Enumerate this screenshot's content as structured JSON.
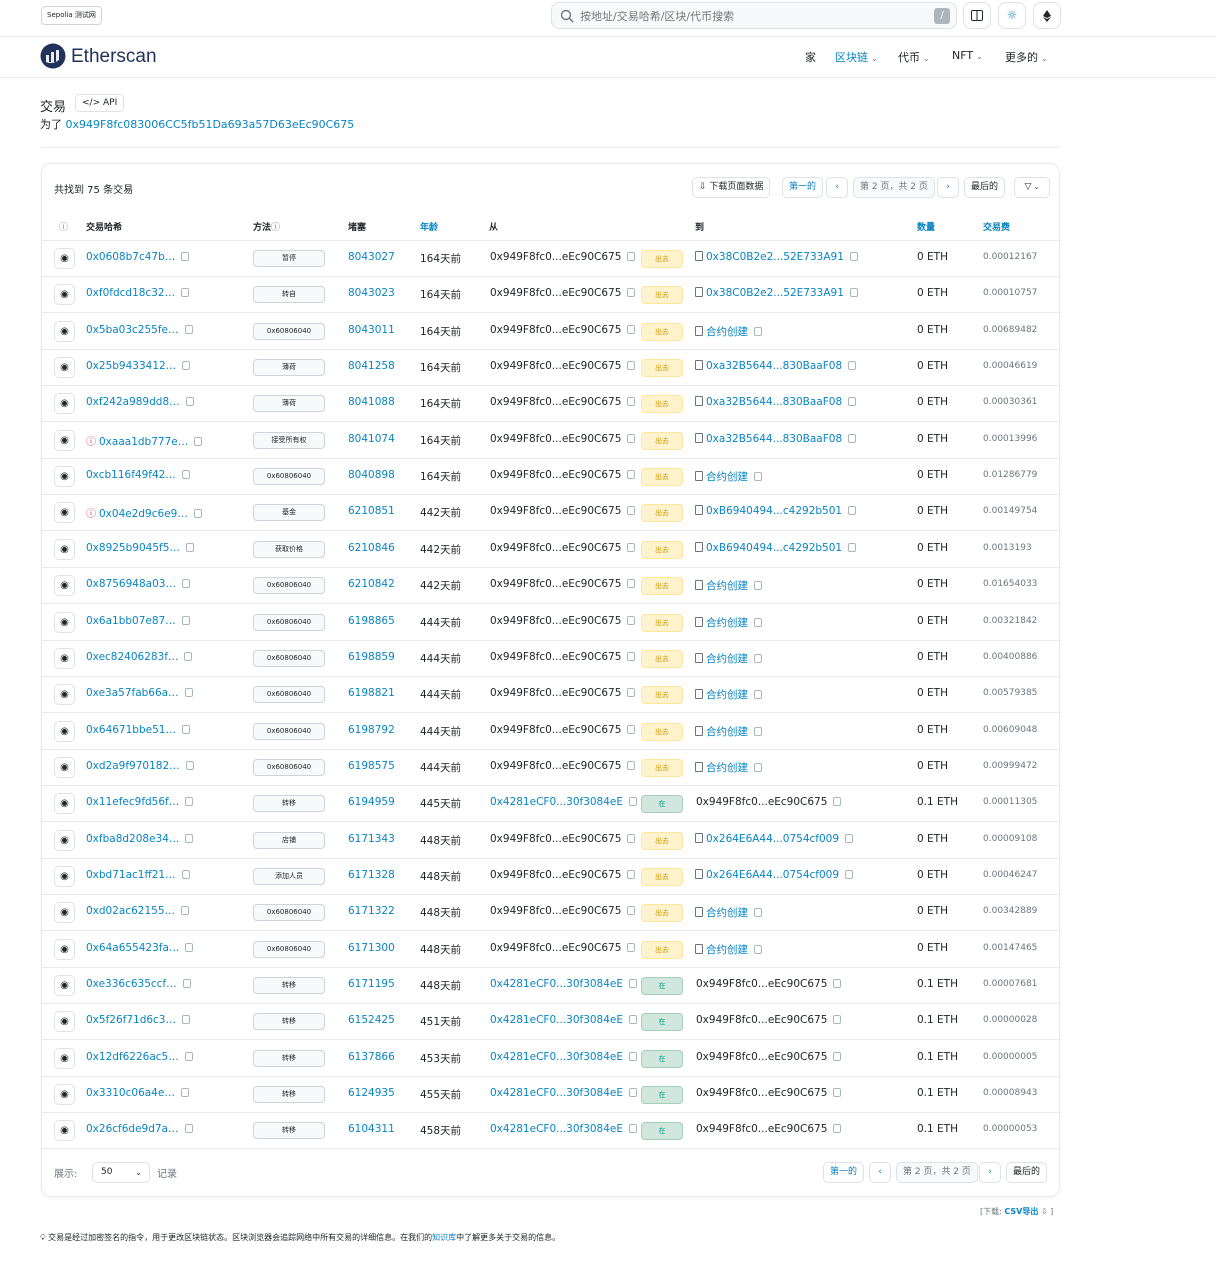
{
  "topbar": {
    "network": "Sepolia 测试网",
    "search_placeholder": "按地址/交易哈希/区块/代币搜索",
    "slash_key": "/"
  },
  "header": {
    "logo_text": "Etherscan",
    "nav": [
      {
        "label": "家",
        "dropdown": false,
        "active": false
      },
      {
        "label": "区块链",
        "dropdown": true,
        "active": true
      },
      {
        "label": "代币",
        "dropdown": true,
        "active": false
      },
      {
        "label": "NFT",
        "dropdown": true,
        "active": false
      },
      {
        "label": "更多的",
        "dropdown": true,
        "active": false
      }
    ]
  },
  "page": {
    "title": "交易",
    "api_label": "API",
    "for_prefix": "为了",
    "address": "0x949F8fc083006CC5fb51Da693a57D63eEc90C675"
  },
  "table_toolbar": {
    "found": "共找到 75 条交易",
    "download": "下载页面数据",
    "first": "第一的",
    "prev": "‹",
    "page_info": "第 2 页，共 2 页",
    "next": "›",
    "last": "最后的",
    "filter": "▽"
  },
  "columns": {
    "hash": "交易哈希",
    "method": "方法",
    "block": "堵塞",
    "age": "年龄",
    "from": "从",
    "to": "到",
    "amount": "数量",
    "fee": "交易费"
  },
  "rows": [
    {
      "hash": "0x0608b7c47b…",
      "err": false,
      "method": "暂停",
      "block": "8043027",
      "age": "164天前",
      "from": "0x949F8fc0...eEc90C675",
      "from_link": false,
      "dir": "出去",
      "dir_type": "out",
      "to": "0x38C0B2e2...52E733A91",
      "to_doc": true,
      "to_link": true,
      "amount": "0 ETH",
      "fee": "0.00012167"
    },
    {
      "hash": "0xf0fdcd18c32…",
      "err": false,
      "method": "转自",
      "block": "8043023",
      "age": "164天前",
      "from": "0x949F8fc0...eEc90C675",
      "from_link": false,
      "dir": "出去",
      "dir_type": "out",
      "to": "0x38C0B2e2...52E733A91",
      "to_doc": true,
      "to_link": true,
      "amount": "0 ETH",
      "fee": "0.00010757"
    },
    {
      "hash": "0x5ba03c255fe…",
      "err": false,
      "method": "0x60806040",
      "block": "8043011",
      "age": "164天前",
      "from": "0x949F8fc0...eEc90C675",
      "from_link": false,
      "dir": "出去",
      "dir_type": "out",
      "to": "合约创建",
      "to_doc": true,
      "to_link": true,
      "amount": "0 ETH",
      "fee": "0.00689482"
    },
    {
      "hash": "0x25b9433412…",
      "err": false,
      "method": "薄荷",
      "block": "8041258",
      "age": "164天前",
      "from": "0x949F8fc0...eEc90C675",
      "from_link": false,
      "dir": "出去",
      "dir_type": "out",
      "to": "0xa32B5644...830BaaF08",
      "to_doc": true,
      "to_link": true,
      "amount": "0 ETH",
      "fee": "0.00046619"
    },
    {
      "hash": "0xf242a989dd8…",
      "err": false,
      "method": "薄荷",
      "block": "8041088",
      "age": "164天前",
      "from": "0x949F8fc0...eEc90C675",
      "from_link": false,
      "dir": "出去",
      "dir_type": "out",
      "to": "0xa32B5644...830BaaF08",
      "to_doc": true,
      "to_link": true,
      "amount": "0 ETH",
      "fee": "0.00030361"
    },
    {
      "hash": "0xaaa1db777e…",
      "err": true,
      "method": "接受所有权",
      "block": "8041074",
      "age": "164天前",
      "from": "0x949F8fc0...eEc90C675",
      "from_link": false,
      "dir": "出去",
      "dir_type": "out",
      "to": "0xa32B5644...830BaaF08",
      "to_doc": true,
      "to_link": true,
      "amount": "0 ETH",
      "fee": "0.00013996"
    },
    {
      "hash": "0xcb116f49f42…",
      "err": false,
      "method": "0x60806040",
      "block": "8040898",
      "age": "164天前",
      "from": "0x949F8fc0...eEc90C675",
      "from_link": false,
      "dir": "出去",
      "dir_type": "out",
      "to": "合约创建",
      "to_doc": true,
      "to_link": true,
      "amount": "0 ETH",
      "fee": "0.01286779"
    },
    {
      "hash": "0x04e2d9c6e9…",
      "err": true,
      "method": "基金",
      "block": "6210851",
      "age": "442天前",
      "from": "0x949F8fc0...eEc90C675",
      "from_link": false,
      "dir": "出去",
      "dir_type": "out",
      "to": "0xB6940494...c4292b501",
      "to_doc": true,
      "to_link": true,
      "amount": "0 ETH",
      "fee": "0.00149754"
    },
    {
      "hash": "0x8925b9045f5…",
      "err": false,
      "method": "获取价格",
      "block": "6210846",
      "age": "442天前",
      "from": "0x949F8fc0...eEc90C675",
      "from_link": false,
      "dir": "出去",
      "dir_type": "out",
      "to": "0xB6940494...c4292b501",
      "to_doc": true,
      "to_link": true,
      "amount": "0 ETH",
      "fee": "0.0013193"
    },
    {
      "hash": "0x8756948a03…",
      "err": false,
      "method": "0x60806040",
      "block": "6210842",
      "age": "442天前",
      "from": "0x949F8fc0...eEc90C675",
      "from_link": false,
      "dir": "出去",
      "dir_type": "out",
      "to": "合约创建",
      "to_doc": true,
      "to_link": true,
      "amount": "0 ETH",
      "fee": "0.01654033"
    },
    {
      "hash": "0x6a1bb07e87…",
      "err": false,
      "method": "0x60806040",
      "block": "6198865",
      "age": "444天前",
      "from": "0x949F8fc0...eEc90C675",
      "from_link": false,
      "dir": "出去",
      "dir_type": "out",
      "to": "合约创建",
      "to_doc": true,
      "to_link": true,
      "amount": "0 ETH",
      "fee": "0.00321842"
    },
    {
      "hash": "0xec82406283f…",
      "err": false,
      "method": "0x60806040",
      "block": "6198859",
      "age": "444天前",
      "from": "0x949F8fc0...eEc90C675",
      "from_link": false,
      "dir": "出去",
      "dir_type": "out",
      "to": "合约创建",
      "to_doc": true,
      "to_link": true,
      "amount": "0 ETH",
      "fee": "0.00400886"
    },
    {
      "hash": "0xe3a57fab66a…",
      "err": false,
      "method": "0x60806040",
      "block": "6198821",
      "age": "444天前",
      "from": "0x949F8fc0...eEc90C675",
      "from_link": false,
      "dir": "出去",
      "dir_type": "out",
      "to": "合约创建",
      "to_doc": true,
      "to_link": true,
      "amount": "0 ETH",
      "fee": "0.00579385"
    },
    {
      "hash": "0x64671bbe51…",
      "err": false,
      "method": "0x60806040",
      "block": "6198792",
      "age": "444天前",
      "from": "0x949F8fc0...eEc90C675",
      "from_link": false,
      "dir": "出去",
      "dir_type": "out",
      "to": "合约创建",
      "to_doc": true,
      "to_link": true,
      "amount": "0 ETH",
      "fee": "0.00609048"
    },
    {
      "hash": "0xd2a9f970182…",
      "err": false,
      "method": "0x60806040",
      "block": "6198575",
      "age": "444天前",
      "from": "0x949F8fc0...eEc90C675",
      "from_link": false,
      "dir": "出去",
      "dir_type": "out",
      "to": "合约创建",
      "to_doc": true,
      "to_link": true,
      "amount": "0 ETH",
      "fee": "0.00999472"
    },
    {
      "hash": "0x11efec9fd56f…",
      "err": false,
      "method": "转移",
      "block": "6194959",
      "age": "445天前",
      "from": "0x4281eCF0...30f3084eE",
      "from_link": true,
      "dir": "在",
      "dir_type": "in",
      "to": "0x949F8fc0...eEc90C675",
      "to_doc": false,
      "to_link": false,
      "amount": "0.1 ETH",
      "fee": "0.00011305"
    },
    {
      "hash": "0xfba8d208e34…",
      "err": false,
      "method": "店铺",
      "block": "6171343",
      "age": "448天前",
      "from": "0x949F8fc0...eEc90C675",
      "from_link": false,
      "dir": "出去",
      "dir_type": "out",
      "to": "0x264E6A44...0754cf009",
      "to_doc": true,
      "to_link": true,
      "amount": "0 ETH",
      "fee": "0.00009108"
    },
    {
      "hash": "0xbd71ac1ff21…",
      "err": false,
      "method": "添加人员",
      "block": "6171328",
      "age": "448天前",
      "from": "0x949F8fc0...eEc90C675",
      "from_link": false,
      "dir": "出去",
      "dir_type": "out",
      "to": "0x264E6A44...0754cf009",
      "to_doc": true,
      "to_link": true,
      "amount": "0 ETH",
      "fee": "0.00046247"
    },
    {
      "hash": "0xd02ac62155…",
      "err": false,
      "method": "0x60806040",
      "block": "6171322",
      "age": "448天前",
      "from": "0x949F8fc0...eEc90C675",
      "from_link": false,
      "dir": "出去",
      "dir_type": "out",
      "to": "合约创建",
      "to_doc": true,
      "to_link": true,
      "amount": "0 ETH",
      "fee": "0.00342889"
    },
    {
      "hash": "0x64a655423fa…",
      "err": false,
      "method": "0x60806040",
      "block": "6171300",
      "age": "448天前",
      "from": "0x949F8fc0...eEc90C675",
      "from_link": false,
      "dir": "出去",
      "dir_type": "out",
      "to": "合约创建",
      "to_doc": true,
      "to_link": true,
      "amount": "0 ETH",
      "fee": "0.00147465"
    },
    {
      "hash": "0xe336c635ccf…",
      "err": false,
      "method": "转移",
      "block": "6171195",
      "age": "448天前",
      "from": "0x4281eCF0...30f3084eE",
      "from_link": true,
      "dir": "在",
      "dir_type": "in",
      "to": "0x949F8fc0...eEc90C675",
      "to_doc": false,
      "to_link": false,
      "amount": "0.1 ETH",
      "fee": "0.00007681"
    },
    {
      "hash": "0x5f26f71d6c3…",
      "err": false,
      "method": "转移",
      "block": "6152425",
      "age": "451天前",
      "from": "0x4281eCF0...30f3084eE",
      "from_link": true,
      "dir": "在",
      "dir_type": "in",
      "to": "0x949F8fc0...eEc90C675",
      "to_doc": false,
      "to_link": false,
      "amount": "0.1 ETH",
      "fee": "0.00000028"
    },
    {
      "hash": "0x12df6226ac5…",
      "err": false,
      "method": "转移",
      "block": "6137866",
      "age": "453天前",
      "from": "0x4281eCF0...30f3084eE",
      "from_link": true,
      "dir": "在",
      "dir_type": "in",
      "to": "0x949F8fc0...eEc90C675",
      "to_doc": false,
      "to_link": false,
      "amount": "0.1 ETH",
      "fee": "0.00000005"
    },
    {
      "hash": "0x3310c06a4e…",
      "err": false,
      "method": "转移",
      "block": "6124935",
      "age": "455天前",
      "from": "0x4281eCF0...30f3084eE",
      "from_link": true,
      "dir": "在",
      "dir_type": "in",
      "to": "0x949F8fc0...eEc90C675",
      "to_doc": false,
      "to_link": false,
      "amount": "0.1 ETH",
      "fee": "0.00008943"
    },
    {
      "hash": "0x26cf6de9d7a…",
      "err": false,
      "method": "转移",
      "block": "6104311",
      "age": "458天前",
      "from": "0x4281eCF0...30f3084eE",
      "from_link": true,
      "dir": "在",
      "dir_type": "in",
      "to": "0x949F8fc0...eEc90C675",
      "to_doc": false,
      "to_link": false,
      "amount": "0.1 ETH",
      "fee": "0.00000053"
    }
  ],
  "footer": {
    "show_label": "展示:",
    "show_value": "50",
    "records_label": "记录",
    "first": "第一的",
    "prev": "‹",
    "page_info": "第 2 页，共 2 页",
    "next": "›",
    "last": "最后的",
    "csv_prefix": "[下载:",
    "csv_link": "CSV导出",
    "csv_suffix": "]",
    "note_a": "交易是经过加密签名的指令，用于更改区块链状态。区块浏览器会追踪网络中所有交易的详细信息。在我们的",
    "note_link": "知识库",
    "note_b": "中了解更多关于交易的信息。"
  },
  "colors": {
    "link": "#0784c3",
    "out_bg": "#fff3cd",
    "in_bg": "#d1e7dd",
    "error": "#dc3545"
  }
}
